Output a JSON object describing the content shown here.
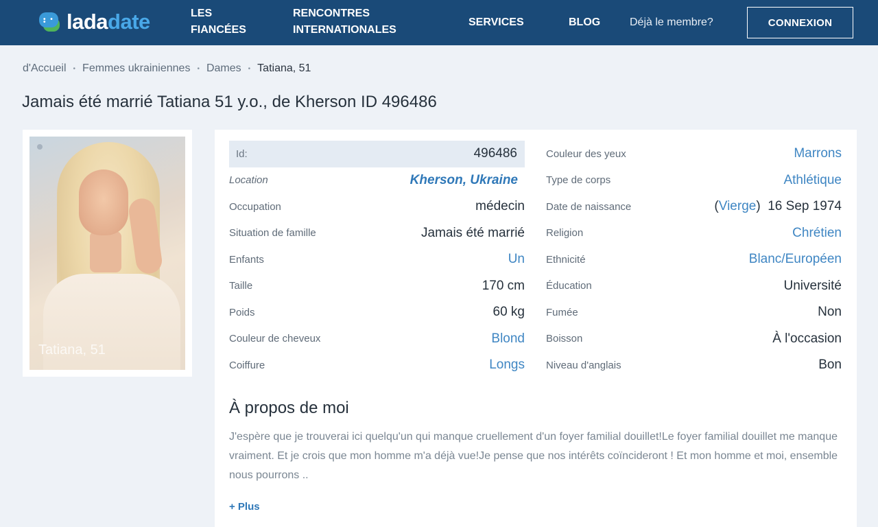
{
  "header": {
    "logo_part1": "lada",
    "logo_part2": "date",
    "nav": {
      "les_fiancees_line1": "LES",
      "les_fiancees_line2": "FIANCÉES",
      "intl_line1": "RENCONTRES",
      "intl_line2": "INTERNATIONALES",
      "services": "SERVICES",
      "blog": "BLOG"
    },
    "member_text": "Déjà le membre?",
    "connect_button": "CONNEXION"
  },
  "breadcrumb": {
    "items": [
      "d'Accueil",
      "Femmes ukrainiennes",
      "Dames"
    ],
    "current": "Tatiana, 51",
    "separator": "•"
  },
  "page_title": "Jamais été marrié Tatiana 51 y.o., de Kherson ID 496486",
  "photo": {
    "caption": "Tatiana, 51"
  },
  "profile": {
    "left": [
      {
        "label": "Id:",
        "value": "496486"
      },
      {
        "label": "Location",
        "value": "Kherson, Ukraine"
      },
      {
        "label": "Occupation",
        "value": "médecin"
      },
      {
        "label": "Situation de famille",
        "value": "Jamais été marrié"
      },
      {
        "label": "Enfants",
        "value": "Un"
      },
      {
        "label": "Taille",
        "value": "170 cm"
      },
      {
        "label": "Poids",
        "value": "60 kg"
      },
      {
        "label": "Couleur de cheveux",
        "value": "Blond"
      },
      {
        "label": "Coiffure",
        "value": "Longs"
      }
    ],
    "right": [
      {
        "label": "Couleur des yeux",
        "value": "Marrons"
      },
      {
        "label": "Type de corps",
        "value": "Athlétique"
      },
      {
        "label": "Date de naissance",
        "zodiac": "Vierge",
        "value": "16 Sep 1974"
      },
      {
        "label": "Religion",
        "value": "Chrétien"
      },
      {
        "label": "Ethnicité",
        "value": "Blanc/Européen"
      },
      {
        "label": "Éducation",
        "value": "Université"
      },
      {
        "label": "Fumée",
        "value": "Non"
      },
      {
        "label": "Boisson",
        "value": "À l'occasion"
      },
      {
        "label": "Niveau d'anglais",
        "value": "Bon"
      }
    ]
  },
  "about": {
    "title": "À propos de moi",
    "text": "J'espère que je trouverai ici quelqu'un qui manque cruellement d'un foyer familial douillet!Le foyer familial douillet me manque vraiment. Et je crois que mon homme m'a déjà vue!Je pense que nos intérêts coïncideront ! Et mon homme et moi, ensemble nous pourrons ..",
    "more": "+ Plus"
  },
  "colors": {
    "header_bg": "#1a4a78",
    "page_bg": "#eef2f7",
    "link": "#3f86c3",
    "logo_accent": "#49a8e8"
  }
}
